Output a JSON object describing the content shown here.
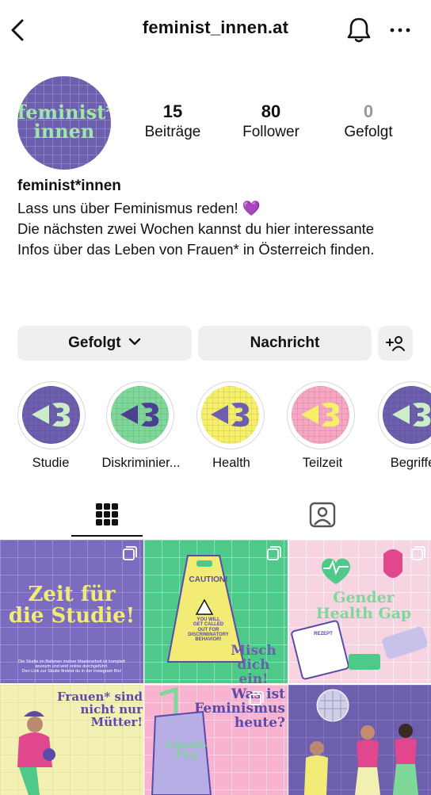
{
  "header": {
    "username": "feminist_innen.at",
    "back_icon": "chevron-left-icon",
    "notification_icon": "bell-icon",
    "more_icon": "more-horizontal-icon"
  },
  "profile": {
    "avatar_text_line1": "feminist*",
    "avatar_text_line2": "innen",
    "avatar_color": "#6d5fae",
    "avatar_text_color": "#9ee6a9",
    "stats": [
      {
        "value": "15",
        "label": "Beiträge"
      },
      {
        "value": "80",
        "label": "Follower"
      },
      {
        "value": "0",
        "label": "Gefolgt"
      }
    ],
    "name": "feminist*innen",
    "bio": [
      "Lass uns über Feminismus reden! 💜",
      "Die nächsten zwei Wochen kannst du hier interessante",
      "Infos über das Leben von Frauen* in Österreich finden."
    ]
  },
  "actions": {
    "follow_label": "Gefolgt",
    "message_label": "Nachricht",
    "add_user_icon": "add-user-icon"
  },
  "highlights": [
    {
      "label": "Studie",
      "bg": "#6d5fae",
      "mark": "#cbeec8"
    },
    {
      "label": "Diskriminier...",
      "bg": "#7fd79a",
      "mark": "#4b3f8f"
    },
    {
      "label": "Health",
      "bg": "#f5ef6a",
      "mark": "#6d5fae"
    },
    {
      "label": "Teilzeit",
      "bg": "#f7a6c4",
      "mark": "#f5ef6a"
    },
    {
      "label": "Begriffe",
      "bg": "#6d5fae",
      "mark": "#cbeec8"
    }
  ],
  "tabs": {
    "grid_icon": "grid-icon",
    "tagged_icon": "tagged-person-icon"
  },
  "posts": [
    {
      "title_line1": "Zeit für",
      "title_line2": "die Studie!",
      "footer1": "Die Studie im Rahmen meiner Masterarbeit ist komplett",
      "footer2": "anonym und wird online durchgeführt.",
      "footer3": "Den Link zur Studie findest du in der Instagram Bio!",
      "bg": "#7b6cc0",
      "text_color": "#f2ec76"
    },
    {
      "sign_title": "CAUTION!",
      "sign_line1": "YOU WILL",
      "sign_line2": "GET CALLED",
      "sign_line3": "OUT FOR",
      "sign_line4": "DISCRIMINATORY",
      "sign_line5": "BEHAVIOR!",
      "caption1": "Misch",
      "caption2": "dich ein!",
      "bg": "#4ec98a",
      "text_color": "#6d5fae"
    },
    {
      "title_line1": "Gender",
      "title_line2": "Health Gap",
      "rezept": "REZEPT",
      "bg": "#f6d4e2",
      "text_color": "#7fd79a"
    },
    {
      "title_line1": "Frauen* sind",
      "title_line2": "nicht nur",
      "title_line3": "Mütter!",
      "bg": "#f3f0b3",
      "text_color": "#5b4aa8"
    },
    {
      "title_line1": "Was ist",
      "title_line2": "Feminismus",
      "title_line3": "heute?",
      "box_label1": "Equali-",
      "box_label2": "TEA",
      "bg": "#f7b3d0",
      "text_color": "#5b4aa8"
    },
    {
      "bg": "#6d5fae"
    }
  ]
}
